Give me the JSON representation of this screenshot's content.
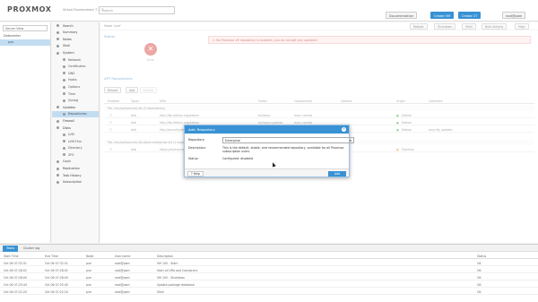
{
  "header": {
    "logo_text": "PROXMOX",
    "subtitle": "Virtual Environment 7.2-7",
    "search_placeholder": "Search",
    "buttons": {
      "documentation": "Documentation",
      "create_vm": "Create VM",
      "create_ct": "Create CT",
      "user": "root@pam"
    }
  },
  "left": {
    "view_select": "Server View",
    "tree": [
      "Datacenter",
      "pve"
    ]
  },
  "nav": {
    "items": [
      {
        "label": "Search",
        "sub": false
      },
      {
        "label": "Summary",
        "sub": false
      },
      {
        "label": "Notes",
        "sub": false
      },
      {
        "label": "Shell",
        "sub": false
      },
      {
        "label": "System",
        "sub": false
      },
      {
        "label": "Network",
        "sub": true
      },
      {
        "label": "Certificates",
        "sub": true
      },
      {
        "label": "DNS",
        "sub": true
      },
      {
        "label": "Hosts",
        "sub": true
      },
      {
        "label": "Options",
        "sub": true
      },
      {
        "label": "Time",
        "sub": true
      },
      {
        "label": "Syslog",
        "sub": true
      },
      {
        "label": "Updates",
        "sub": false
      },
      {
        "label": "Repositories",
        "sub": true,
        "selected": true
      },
      {
        "label": "Firewall",
        "sub": false
      },
      {
        "label": "Disks",
        "sub": false
      },
      {
        "label": "LVM",
        "sub": true
      },
      {
        "label": "LVM-Thin",
        "sub": true
      },
      {
        "label": "Directory",
        "sub": true
      },
      {
        "label": "ZFS",
        "sub": true
      },
      {
        "label": "Ceph",
        "sub": false
      },
      {
        "label": "Replication",
        "sub": false
      },
      {
        "label": "Task History",
        "sub": false
      },
      {
        "label": "Subscription",
        "sub": false
      }
    ]
  },
  "content": {
    "node_title": "Node 'pve'",
    "head_buttons": {
      "reboot": "Reboot",
      "shutdown": "Shutdown",
      "shell": "Shell",
      "bulk_actions": "Bulk Actions",
      "help": "Help"
    },
    "status_title": "Status",
    "status_label": "Error",
    "warning": "No Proxmox VE repository is enabled, you do not get any updates!",
    "repo_title": "APT Repositories",
    "toolbar": {
      "reload": "Reload",
      "add": "Add",
      "enable": "Enable"
    },
    "columns": [
      "Enabled",
      "Types",
      "URIs",
      "Suites",
      "Components",
      "Options",
      "Origin",
      "Comment"
    ],
    "group1": "File: /etc/apt/sources.list (3 repositories)",
    "rows1": [
      {
        "types": "deb",
        "uri": "http://ftp.debian.org/debian",
        "suite": "bullseye",
        "components": "main contrib",
        "origin": "Debian",
        "comment": ""
      },
      {
        "types": "deb",
        "uri": "http://ftp.debian.org/debian",
        "suite": "bullseye-updates",
        "components": "main contrib",
        "origin": "Debian",
        "comment": ""
      },
      {
        "types": "deb",
        "uri": "http://security.debian.org",
        "suite": "bullseye-security",
        "components": "main contrib",
        "origin": "Debian",
        "comment": "security updates"
      }
    ],
    "group2": "File: /etc/apt/sources.list.d/pve-enterprise.list (1 repository)",
    "rows2": [
      {
        "types": "deb",
        "uri": "https://enterprise.proxmox.com/debian/pve",
        "suite": "bullseye",
        "components": "pve-enterprise",
        "origin": "Proxmox",
        "comment": ""
      }
    ]
  },
  "dialog": {
    "title": "Add: Repository",
    "repository_label": "Repository:",
    "repository_value": "Enterprise",
    "description_label": "Description:",
    "description_value": "This is the default, stable, and recommended repository, available for all Proxmox subscription users.",
    "status_label": "Status:",
    "status_value": "Configured: disabled",
    "help_label": "Help",
    "add_label": "Add"
  },
  "log": {
    "tabs": [
      "Tasks",
      "Cluster log"
    ],
    "columns": [
      "Start Time",
      "End Time",
      "Node",
      "User name",
      "Description",
      "Status"
    ],
    "rows": [
      {
        "start": "Oct 06 07:32:31",
        "end": "Oct 06 07:32:31",
        "node": "pve",
        "user": "root@pam",
        "desc": "VM 100 - Start",
        "status": "OK"
      },
      {
        "start": "Oct 06 07:28:02",
        "end": "Oct 06 07:28:02",
        "node": "pve",
        "user": "root@pam",
        "desc": "Start all VMs and Containers",
        "status": "OK"
      },
      {
        "start": "Oct 06 07:28:00",
        "end": "Oct 06 07:28:00",
        "node": "pve",
        "user": "root@pam",
        "desc": "VM 100 - Shutdown",
        "status": "OK"
      },
      {
        "start": "Oct 06 07:25:44",
        "end": "Oct 06 07:25:45",
        "node": "pve",
        "user": "root@pam",
        "desc": "Update package database",
        "status": "OK"
      },
      {
        "start": "Oct 06 07:22:20",
        "end": "Oct 06 07:22:20",
        "node": "pve",
        "user": "root@pam",
        "desc": "Shell",
        "status": "OK"
      }
    ]
  }
}
